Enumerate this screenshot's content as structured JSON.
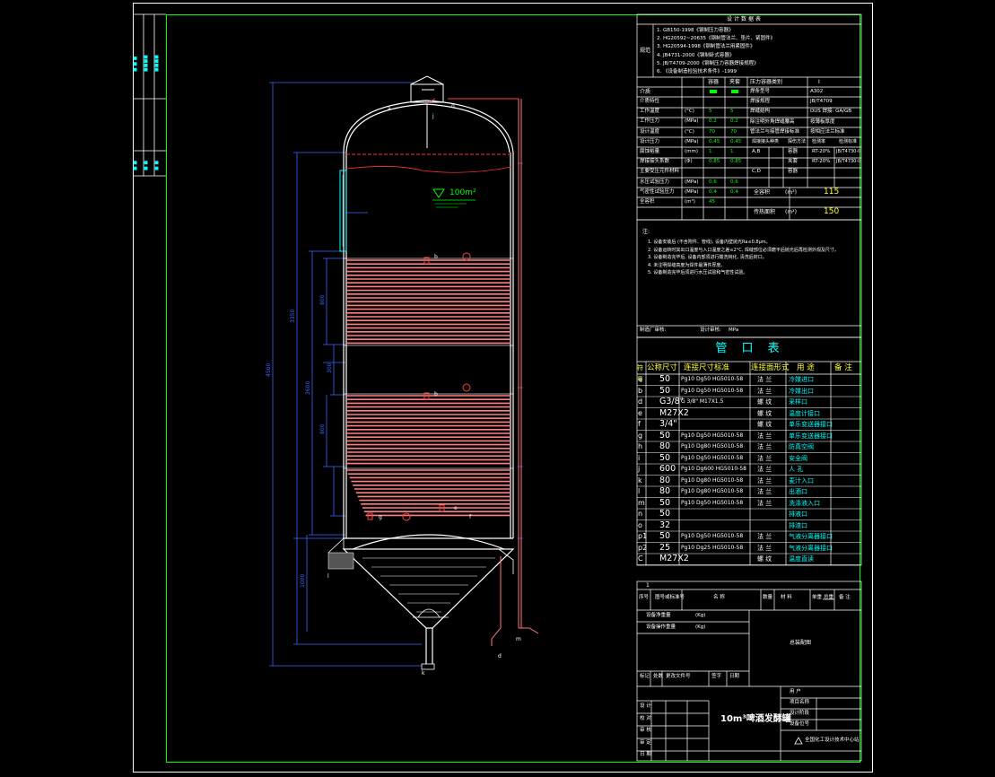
{
  "design_data_title": "设计数据表",
  "standards": [
    "1. GB150-1998《钢制压力容器》",
    "2. HG20592~20635《钢制管法兰、垫片、紧固件》",
    "3. HG20594-1998《钢制管法兰用紧固件》",
    "4. JB4731-2000《钢制卧式容器》",
    "5. JB/T4709-2000《钢制压力容器焊接规程》",
    "6. 《设备制造检验技术条件》-1999"
  ],
  "standards_label": "规范",
  "process_params_header": [
    "容器",
    "夹套"
  ],
  "vessel_class_label": "压力容器类别",
  "vessel_class_value": "I",
  "medium_label": "介质",
  "medium_colors": [
    "#00ff00",
    "#00ff00"
  ],
  "weld_method_value": "A302",
  "weld_std_value": "JB/T4709",
  "params": [
    {
      "label": "介质特性",
      "v1": "",
      "v2": ""
    },
    {
      "label": "工作温度",
      "unit": "(°C)",
      "v1": "5",
      "v2": "5"
    },
    {
      "label": "工作压力",
      "unit": "(MPa)",
      "v1": "0.2",
      "v2": "0.2"
    },
    {
      "label": "设计温度",
      "unit": "(°C)",
      "v1": "70",
      "v2": "70"
    },
    {
      "label": "设计压力",
      "unit": "(MPa)",
      "v1": "0.45",
      "v2": "0.45"
    },
    {
      "label": "腐蚀裕量",
      "unit": "(mm)",
      "v1": "1",
      "v2": "1"
    },
    {
      "label": "焊接接头系数",
      "unit": "(Φ)",
      "v1": "0.85",
      "v2": "0.85"
    },
    {
      "label": "主要受压元件材料",
      "v1": "",
      "v2": ""
    },
    {
      "label": "水压试验压力",
      "unit": "(MPa)",
      "v1": "0.6",
      "v2": "0.6"
    },
    {
      "label": "气密性试验压力",
      "unit": "(MPa)",
      "v1": "0.4",
      "v2": "0.4"
    },
    {
      "label": "全容积",
      "unit": "(m³)",
      "v1": "45",
      "v2": ""
    }
  ],
  "right_params": [
    {
      "label": "焊条型号",
      "value": "A302"
    },
    {
      "label": "焊接规程",
      "value": "JB/T4709"
    },
    {
      "label": "焊缝结构",
      "value": "DUS 焊接: GA/GB"
    },
    {
      "label": "除注明外角焊缝腰高",
      "value": "按薄板厚度"
    },
    {
      "label": "管法兰与接管焊接标准",
      "value": "按相应法兰标准"
    }
  ],
  "ndt_header": [
    "焊接接头种类",
    "探伤方法",
    "检测率",
    "检测标准"
  ],
  "ndt_rows": [
    {
      "cls": "A,B",
      "grade": "容器",
      "method": "RT-20%",
      "std": "JB/T4730-II"
    },
    {
      "cls": "",
      "grade": "夹套",
      "method": "RT-20%",
      "std": "JB/T4730-II"
    },
    {
      "cls": "C,D",
      "grade": "容器",
      "method": "",
      "std": ""
    }
  ],
  "full_volume_label": "全容积",
  "full_volume_unit": "(m³)",
  "full_volume_value": "115",
  "heat_area_label": "传热面积",
  "heat_area_unit": "(m²)",
  "heat_area_value": "150",
  "notes_title": "注:",
  "notes": [
    "1. 设备安装后 (不含附件、管线), 设备内壁抛光Ra≤0.8μm。",
    "2. 设备运转时其出口温度与入口温度之差≤2°C, 焊缝部位必须磨平后抛光后再检测外观及尺寸。",
    "3. 设备制造完毕后, 设备内部须进行酸洗钝化, 清洗后封口。",
    "4. 未注明焊缝高度为焊件最薄件厚度。",
    "5. 设备制造完毕后须进行水压试验和气密性试验。"
  ],
  "sign_line": [
    "制造厂审核:",
    "设计审核:",
    "MPa"
  ],
  "nozzle_table_title": "管 口 表",
  "nozzle_headers": [
    "符号",
    "公称尺寸",
    "连接尺寸标准",
    "连接面形式",
    "用 途",
    "备 注"
  ],
  "nozzles": [
    {
      "sym": "a",
      "dn": "50",
      "std": "Pg10 Dg50 HG5010-58",
      "face": "法 兰",
      "use": "冷媒进口"
    },
    {
      "sym": "b",
      "dn": "50",
      "std": "Pg10 Dg50 HG5010-58",
      "face": "法 兰",
      "use": "冷媒出口"
    },
    {
      "sym": "d",
      "dn": "G3/8\"",
      "std": "G 3/8\"  M17X1.5",
      "face": "螺 纹",
      "use": "采样口"
    },
    {
      "sym": "e",
      "dn": "M27X2",
      "std": "",
      "face": "螺 纹",
      "use": "温度计接口"
    },
    {
      "sym": "f",
      "dn": "3/4\"",
      "std": "",
      "face": "螺 纹",
      "use": "单乐变送器接口"
    },
    {
      "sym": "g",
      "dn": "50",
      "std": "Pg10 Dg50 HG5010-58",
      "face": "法 兰",
      "use": "单乐变送器接口"
    },
    {
      "sym": "h",
      "dn": "80",
      "std": "Pg10 Dg80 HG5010-58",
      "face": "法 兰",
      "use": "防真空阀"
    },
    {
      "sym": "i",
      "dn": "50",
      "std": "Pg10 Dg50 HG5010-58",
      "face": "法 兰",
      "use": "安全阀"
    },
    {
      "sym": "j",
      "dn": "600",
      "std": "Pg10 Dg600 HG5010-58",
      "face": "法 兰",
      "use": "人 孔"
    },
    {
      "sym": "k",
      "dn": "80",
      "std": "Pg10 Dg80 HG5010-58",
      "face": "法 兰",
      "use": "麦汁入口"
    },
    {
      "sym": "l",
      "dn": "80",
      "std": "Pg10 Dg80 HG5010-58",
      "face": "法 兰",
      "use": "出酒口"
    },
    {
      "sym": "m",
      "dn": "50",
      "std": "Pg10 Dg50 HG5010-58",
      "face": "法 兰",
      "use": "洗涤液入口"
    },
    {
      "sym": "n",
      "dn": "50",
      "std": "",
      "face": "",
      "use": "排液口"
    },
    {
      "sym": "o",
      "dn": "32",
      "std": "",
      "face": "",
      "use": "排渣口"
    },
    {
      "sym": "p1",
      "dn": "50",
      "std": "Pg10 Dg50 HG5010-58",
      "face": "法 兰",
      "use": "气液分离器接口"
    },
    {
      "sym": "p2",
      "dn": "25",
      "std": "Pg10 Dg25 HG5010-58",
      "face": "法 兰",
      "use": "气液分离器接口"
    },
    {
      "sym": "C",
      "dn": "M27X2",
      "std": "",
      "face": "螺 纹",
      "use": "温度直读"
    }
  ],
  "parts_list_num": "1",
  "parts_headers": [
    "序号",
    "图号或标准号",
    "名 称",
    "数量",
    "材 料",
    "单重",
    "总重",
    "备 注"
  ],
  "weight_rows": [
    "设备净重量",
    "(Kg)",
    "设备操作重量",
    "(Kg)"
  ],
  "proj_label": "总装配图",
  "title_rows": [
    "标记",
    "处数",
    "更改文件号",
    "签字",
    "日期"
  ],
  "sign_rows": [
    "设 计",
    "校 对",
    "审 核",
    "审 定",
    "日 期"
  ],
  "title_block_labels": [
    "用 户",
    "项目名称",
    "设计阶段",
    "设备位号"
  ],
  "drawing_title": "10m³啤酒发酵罐",
  "company": "全国化工设计技术中心站",
  "liquid_level": "100m²",
  "side_labels": [
    "附图",
    "标记",
    "版本",
    "图号"
  ]
}
